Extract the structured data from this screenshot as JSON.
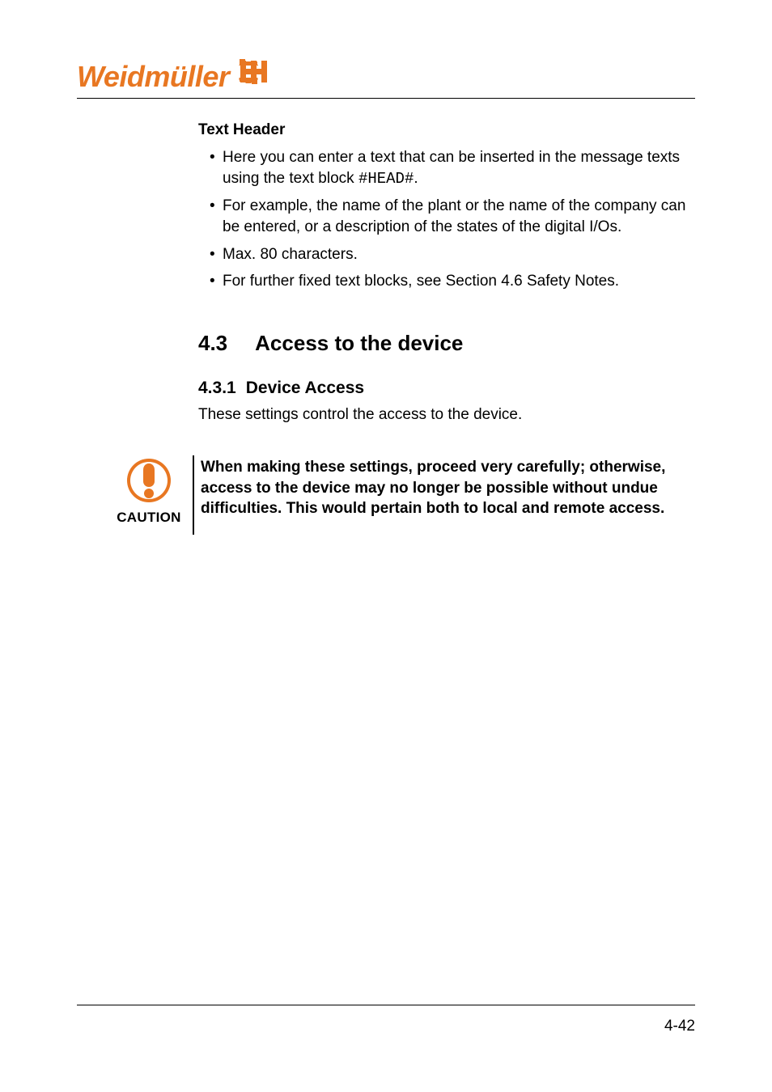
{
  "brand": {
    "name": "Weidmüller"
  },
  "textHeader": {
    "title": "Text Header",
    "bullets": [
      {
        "prefix": "Here you can enter a text that can be inserted in the message texts using the text block ",
        "code": "#HEAD#",
        "suffix": "."
      },
      {
        "text": "For example, the name of the plant or the name of the company can be entered, or a description of the states of the digital I/Os."
      },
      {
        "text": "Max. 80 characters."
      },
      {
        "text": "For further fixed text blocks, see Section 4.6 Safety Notes."
      }
    ]
  },
  "section": {
    "number": "4.3",
    "title": "Access to the device"
  },
  "subsection": {
    "number": "4.3.1",
    "title": "Device Access",
    "intro": "These settings control the access to the device."
  },
  "caution": {
    "label": "CAUTION",
    "text": "When making these settings, proceed very carefully; otherwise, access to the device may no longer be possible without undue difficulties. This would pertain both to local and remote access."
  },
  "footer": {
    "pageNumber": "4-42"
  }
}
